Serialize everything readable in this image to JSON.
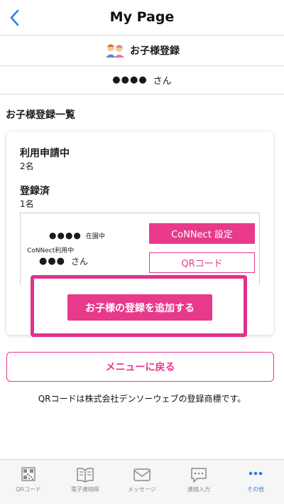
{
  "nav": {
    "title": "My Page"
  },
  "registration_header": {
    "title": "お子様登録"
  },
  "user": {
    "name_masked": "●●●●",
    "honorific": "さん"
  },
  "section": {
    "title": "お子様登録一覧"
  },
  "summary": {
    "pending_label": "利用申請中",
    "pending_count": "2名",
    "registered_label": "登録済",
    "registered_count": "1名"
  },
  "child": {
    "name_masked": "●●●●",
    "status": "在園中",
    "connect_status": "CoNNect利用中",
    "guardian_masked": "●●●",
    "guardian_honorific": "さん",
    "connect_settings_label": "CoNNect 設定",
    "qr_label": "QRコード"
  },
  "add_child_label": "お子様の登録を追加する",
  "back_to_menu_label": "メニューに戻る",
  "trademark_note": "QRコードは株式会社デンソーウェブの登録商標です。",
  "tabs": [
    {
      "label": "QRコード",
      "icon": "qr-code-icon",
      "active": false
    },
    {
      "label": "電子連絡帳",
      "icon": "notebook-icon",
      "active": false
    },
    {
      "label": "メッセージ",
      "icon": "envelope-icon",
      "active": false
    },
    {
      "label": "連絡入力",
      "icon": "chat-input-icon",
      "active": false
    },
    {
      "label": "その他",
      "icon": "more-icon",
      "active": true
    }
  ],
  "colors": {
    "accent": "#e8398b",
    "highlight": "#e0328a",
    "tab_active": "#2f7de1",
    "tab_inactive": "#8a8a8a"
  }
}
